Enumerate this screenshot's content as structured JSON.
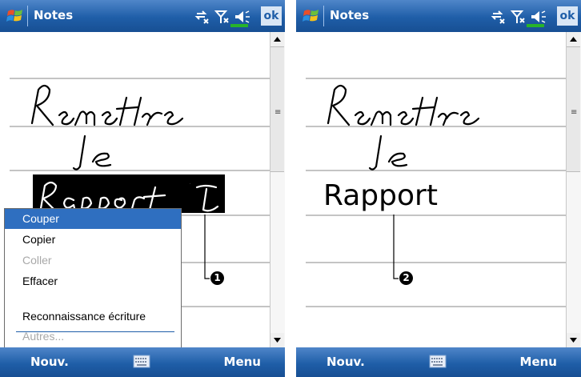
{
  "left_screen": {
    "title": "Notes",
    "ok_label": "ok",
    "toolbar": {
      "new_label": "Nouv.",
      "menu_label": "Menu"
    },
    "context_menu": {
      "items": [
        {
          "label": "Couper",
          "state": "selected"
        },
        {
          "label": "Copier",
          "state": "enabled"
        },
        {
          "label": "Coller",
          "state": "disabled"
        },
        {
          "label": "Effacer",
          "state": "enabled"
        },
        {
          "label": "Reconnaissance écriture",
          "state": "enabled"
        },
        {
          "label": "Autres...",
          "state": "disabled"
        }
      ]
    },
    "callout": "1"
  },
  "right_screen": {
    "title": "Notes",
    "ok_label": "ok",
    "toolbar": {
      "new_label": "Nouv.",
      "menu_label": "Menu"
    },
    "recognized_word": "Rapport",
    "callout": "2"
  },
  "handwriting": {
    "lines": [
      "Remettre",
      "le",
      "Rapport"
    ]
  },
  "colors": {
    "title_bar": "#1f5ea8",
    "selection": "#2f6fc0",
    "rule_lines": "#8a8a8a"
  },
  "icons": [
    "windows-start-icon",
    "connectivity-icon",
    "signal-icon",
    "volume-icon",
    "keyboard-icon",
    "scroll-up-icon",
    "scroll-down-icon"
  ]
}
